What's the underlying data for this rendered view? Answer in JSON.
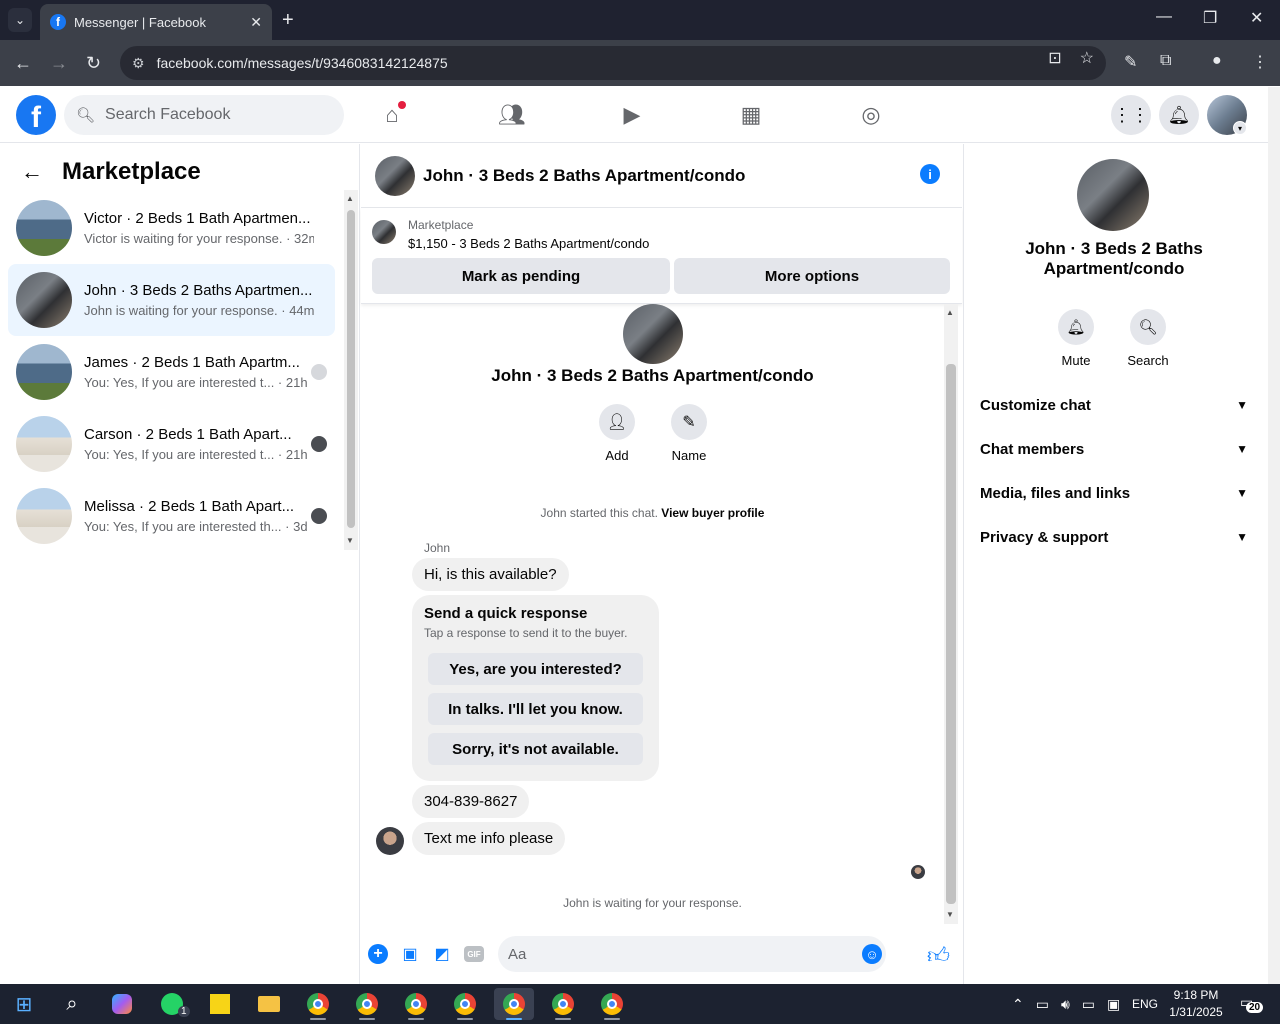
{
  "browser": {
    "tab_title": "Messenger | Facebook",
    "url": "facebook.com/messages/t/9346083142124875"
  },
  "header": {
    "search_placeholder": "Search Facebook"
  },
  "left": {
    "title": "Marketplace",
    "conversations": [
      {
        "name": "Victor · 2 Beds 1 Bath Apartmen...",
        "sub": "Victor is waiting for your response. · 32m"
      },
      {
        "name": "John · 3 Beds 2 Baths Apartmen...",
        "sub": "John is waiting for your response. · 44m"
      },
      {
        "name": "James · 2 Beds 1 Bath Apartm...",
        "sub": "You: Yes, If you are interested t... · 21h"
      },
      {
        "name": "Carson · 2 Beds 1 Bath Apart...",
        "sub": "You: Yes, If you are interested t... · 21h"
      },
      {
        "name": "Melissa · 2 Beds 1 Bath Apart...",
        "sub": "You: Yes, If you are interested th... · 3d"
      }
    ]
  },
  "chat": {
    "title": "John · 3 Beds 2 Baths Apartment/condo",
    "marketplace_label": "Marketplace",
    "listing": "$1,150 - 3 Beds 2 Baths Apartment/condo",
    "mark_pending": "Mark as pending",
    "more_options": "More options",
    "thread_title": "John · 3 Beds 2 Baths Apartment/condo",
    "add_label": "Add",
    "name_label": "Name",
    "started_text": "John started this chat.",
    "view_profile": "View buyer profile",
    "sender": "John",
    "msg1": "Hi, is this available?",
    "quick_title": "Send a quick response",
    "quick_sub": "Tap a response to send it to the buyer.",
    "quick_options": [
      "Yes, are you interested?",
      "In talks. I'll let you know.",
      "Sorry, it's not available."
    ],
    "msg2": "304-839-8627",
    "msg3": "Text me info please",
    "waiting": "John is waiting for your response.",
    "composer_placeholder": "Aa",
    "gif_label": "GIF"
  },
  "right": {
    "title": "John · 3 Beds 2 Baths Apartment/condo",
    "mute_label": "Mute",
    "search_label": "Search",
    "sections": [
      "Customize chat",
      "Chat members",
      "Media, files and links",
      "Privacy & support"
    ]
  },
  "taskbar": {
    "time": "9:18 PM",
    "date": "1/31/2025",
    "lang": "ENG",
    "whatsapp_badge": "1",
    "notif_count": "20"
  }
}
